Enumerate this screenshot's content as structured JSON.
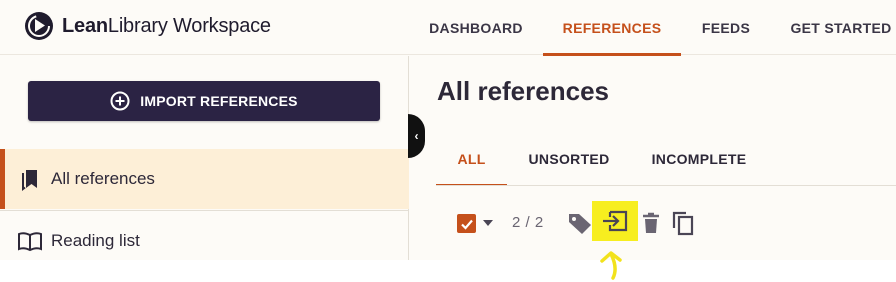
{
  "header": {
    "brand_bold": "Lean",
    "brand_regular": "Library Workspace",
    "nav": [
      {
        "label": "DASHBOARD",
        "active": false
      },
      {
        "label": "REFERENCES",
        "active": true
      },
      {
        "label": "FEEDS",
        "active": false
      },
      {
        "label": "GET STARTED",
        "active": false
      }
    ]
  },
  "sidebar": {
    "import_label": "IMPORT REFERENCES",
    "collapse_glyph": "‹",
    "items": [
      {
        "label": "All references",
        "icon": "bookmarks-icon",
        "active": true
      },
      {
        "label": "Reading list",
        "icon": "open-book-icon",
        "active": false
      }
    ]
  },
  "main": {
    "title": "All references",
    "tabs": [
      {
        "label": "ALL",
        "active": true
      },
      {
        "label": "UNSORTED",
        "active": false
      },
      {
        "label": "INCOMPLETE",
        "active": false
      }
    ],
    "selection_count": "2 / 2",
    "toolbar": [
      "tag-icon",
      "move-to-list-icon",
      "delete-icon",
      "copy-icon"
    ]
  },
  "colors": {
    "accent": "#c5501b",
    "brand_dark": "#2b2344",
    "active_row_bg": "#fdefd7",
    "highlight": "#f7ee1f",
    "annotation_arrow": "#f2e21c"
  }
}
